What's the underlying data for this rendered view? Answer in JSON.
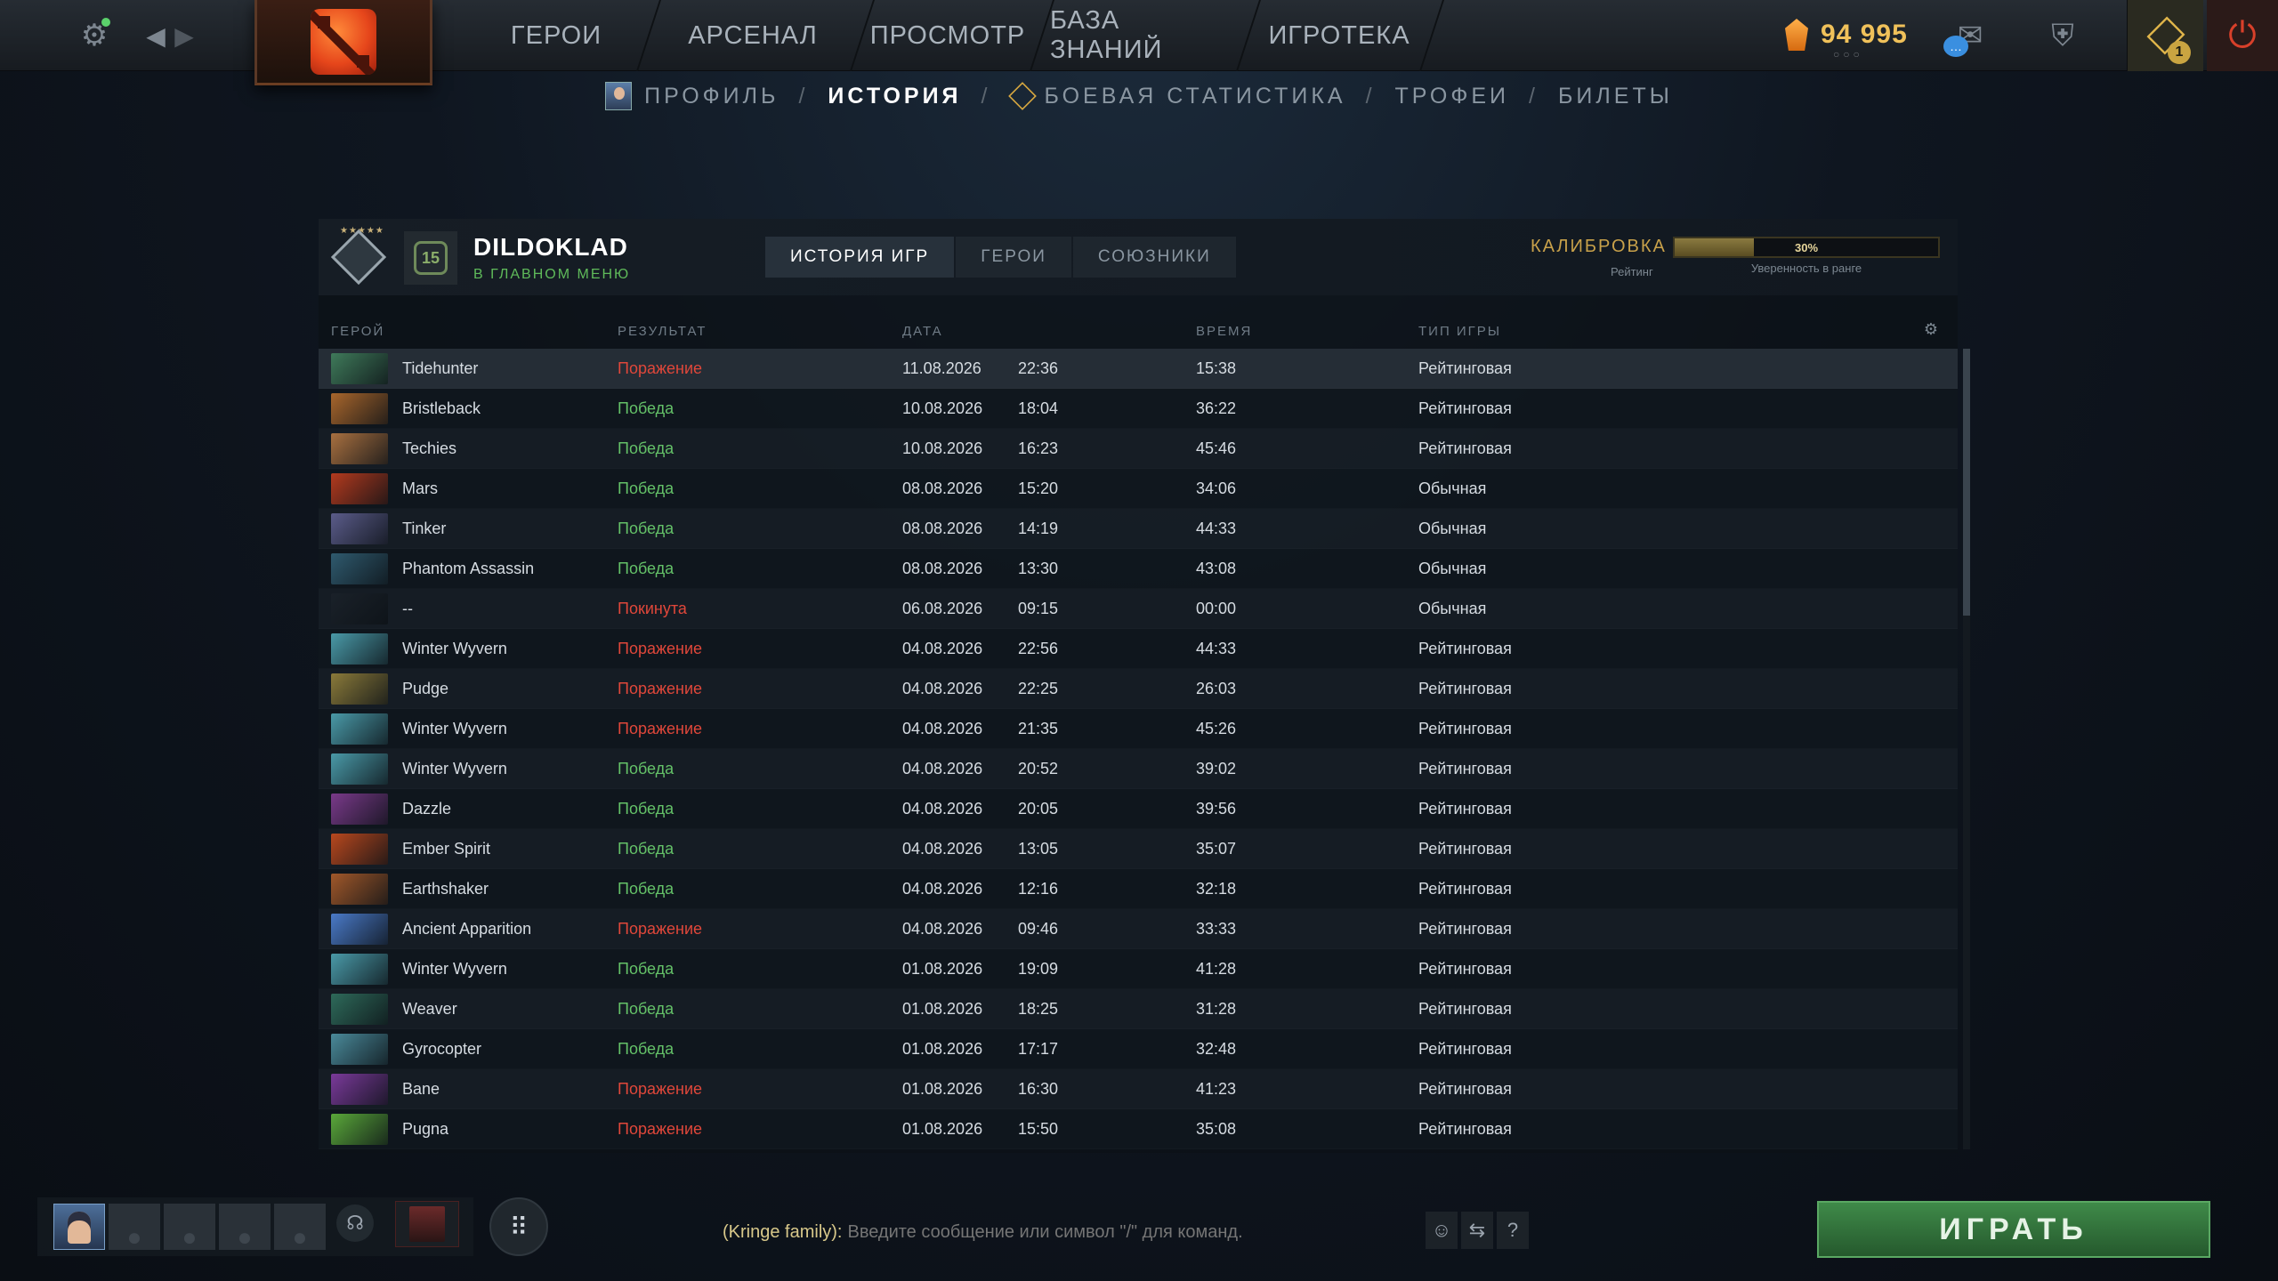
{
  "top_nav": {
    "items": [
      "ГЕРОИ",
      "АРСЕНАЛ",
      "ПРОСМОТР",
      "БАЗА ЗНАНИЙ",
      "ИГРОТЕКА"
    ],
    "shards": "94 995",
    "quest_count": "1"
  },
  "sub_nav": {
    "items": [
      "ПРОФИЛЬ",
      "ИСТОРИЯ",
      "БОЕВАЯ СТАТИСТИКА",
      "ТРОФЕИ",
      "БИЛЕТЫ"
    ],
    "active": "ИСТОРИЯ"
  },
  "profile": {
    "name": "DILDOKLAD",
    "status": "В ГЛАВНОМ МЕНЮ",
    "level": "15",
    "tabs": [
      "ИСТОРИЯ ИГР",
      "ГЕРОИ",
      "СОЮЗНИКИ"
    ],
    "active_tab": "ИСТОРИЯ ИГР",
    "calibration_label": "КАЛИБРОВКА",
    "rating_label": "Рейтинг",
    "confidence_percent": "30%",
    "confidence_fraction": 0.3,
    "confidence_label": "Уверенность в ранге"
  },
  "table": {
    "headers": {
      "hero": "ГЕРОЙ",
      "result": "РЕЗУЛЬТАТ",
      "date": "ДАТА",
      "duration": "ВРЕМЯ",
      "type": "ТИП ИГРЫ"
    },
    "rows": [
      {
        "hero": "Tidehunter",
        "result": "Поражение",
        "win": false,
        "date": "11.08.2026",
        "time": "22:36",
        "duration": "15:38",
        "type": "Рейтинговая",
        "color": "#3f7a5a"
      },
      {
        "hero": "Bristleback",
        "result": "Победа",
        "win": true,
        "date": "10.08.2026",
        "time": "18:04",
        "duration": "36:22",
        "type": "Рейтинговая",
        "color": "#a8662c"
      },
      {
        "hero": "Techies",
        "result": "Победа",
        "win": true,
        "date": "10.08.2026",
        "time": "16:23",
        "duration": "45:46",
        "type": "Рейтинговая",
        "color": "#a87040"
      },
      {
        "hero": "Mars",
        "result": "Победа",
        "win": true,
        "date": "08.08.2026",
        "time": "15:20",
        "duration": "34:06",
        "type": "Обычная",
        "color": "#b33a1e"
      },
      {
        "hero": "Tinker",
        "result": "Победа",
        "win": true,
        "date": "08.08.2026",
        "time": "14:19",
        "duration": "44:33",
        "type": "Обычная",
        "color": "#5b5c8a"
      },
      {
        "hero": "Phantom Assassin",
        "result": "Победа",
        "win": true,
        "date": "08.08.2026",
        "time": "13:30",
        "duration": "43:08",
        "type": "Обычная",
        "color": "#2f5a6e"
      },
      {
        "hero": "--",
        "result": "Покинута",
        "win": false,
        "date": "06.08.2026",
        "time": "09:15",
        "duration": "00:00",
        "type": "Обычная",
        "color": "#1a2129"
      },
      {
        "hero": "Winter Wyvern",
        "result": "Поражение",
        "win": false,
        "date": "04.08.2026",
        "time": "22:56",
        "duration": "44:33",
        "type": "Рейтинговая",
        "color": "#4a9aa8"
      },
      {
        "hero": "Pudge",
        "result": "Поражение",
        "win": false,
        "date": "04.08.2026",
        "time": "22:25",
        "duration": "26:03",
        "type": "Рейтинговая",
        "color": "#8a7a3a"
      },
      {
        "hero": "Winter Wyvern",
        "result": "Поражение",
        "win": false,
        "date": "04.08.2026",
        "time": "21:35",
        "duration": "45:26",
        "type": "Рейтинговая",
        "color": "#4a9aa8"
      },
      {
        "hero": "Winter Wyvern",
        "result": "Победа",
        "win": true,
        "date": "04.08.2026",
        "time": "20:52",
        "duration": "39:02",
        "type": "Рейтинговая",
        "color": "#4a9aa8"
      },
      {
        "hero": "Dazzle",
        "result": "Победа",
        "win": true,
        "date": "04.08.2026",
        "time": "20:05",
        "duration": "39:56",
        "type": "Рейтинговая",
        "color": "#7a3a8a"
      },
      {
        "hero": "Ember Spirit",
        "result": "Победа",
        "win": true,
        "date": "04.08.2026",
        "time": "13:05",
        "duration": "35:07",
        "type": "Рейтинговая",
        "color": "#b8481e"
      },
      {
        "hero": "Earthshaker",
        "result": "Победа",
        "win": true,
        "date": "04.08.2026",
        "time": "12:16",
        "duration": "32:18",
        "type": "Рейтинговая",
        "color": "#a0582a"
      },
      {
        "hero": "Ancient Apparition",
        "result": "Поражение",
        "win": false,
        "date": "04.08.2026",
        "time": "09:46",
        "duration": "33:33",
        "type": "Рейтинговая",
        "color": "#4a7ac8"
      },
      {
        "hero": "Winter Wyvern",
        "result": "Победа",
        "win": true,
        "date": "01.08.2026",
        "time": "19:09",
        "duration": "41:28",
        "type": "Рейтинговая",
        "color": "#4a9aa8"
      },
      {
        "hero": "Weaver",
        "result": "Победа",
        "win": true,
        "date": "01.08.2026",
        "time": "18:25",
        "duration": "31:28",
        "type": "Рейтинговая",
        "color": "#2e6a5a"
      },
      {
        "hero": "Gyrocopter",
        "result": "Победа",
        "win": true,
        "date": "01.08.2026",
        "time": "17:17",
        "duration": "32:48",
        "type": "Рейтинговая",
        "color": "#4a8a9a"
      },
      {
        "hero": "Bane",
        "result": "Поражение",
        "win": false,
        "date": "01.08.2026",
        "time": "16:30",
        "duration": "41:23",
        "type": "Рейтинговая",
        "color": "#7a3a9a"
      },
      {
        "hero": "Pugna",
        "result": "Поражение",
        "win": false,
        "date": "01.08.2026",
        "time": "15:50",
        "duration": "35:08",
        "type": "Рейтинговая",
        "color": "#5aa83a"
      }
    ]
  },
  "chat": {
    "channel": "(Kringe family):",
    "placeholder": "Введите сообщение или символ \"/\" для команд."
  },
  "play_button": "ИГРАТЬ",
  "colors": {
    "win": "#64c168",
    "loss": "#e0473a",
    "gold": "#f0c15a",
    "play": "#3f8a49"
  }
}
